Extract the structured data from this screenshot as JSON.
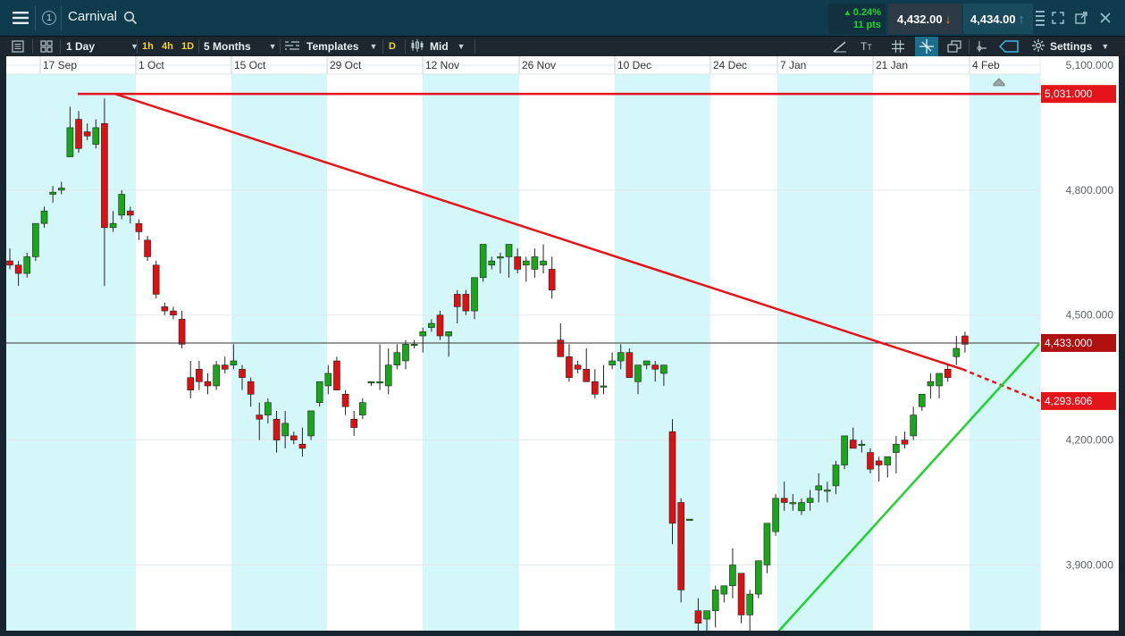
{
  "topbar": {
    "menu_icon": "hamburger-menu-icon",
    "badge": "1",
    "title": "Carnival",
    "search_icon": "search-icon",
    "change_pct": "0.24%",
    "change_pts": "11 pts",
    "sell_price": "4,432.00",
    "buy_price": "4,434.00",
    "colors": {
      "up": "#1fd32f",
      "sell_bg": "#2b3a44",
      "buy_bg": "#1a4b5d"
    }
  },
  "toolbar": {
    "interval": "1 Day",
    "btn_1h": "1h",
    "btn_4h": "4h",
    "btn_1d": "1D",
    "period": "5 Months",
    "templates": "Templates",
    "d": "D",
    "price_type": "Mid",
    "settings": "Settings"
  },
  "chart_data": {
    "type": "candlestick",
    "title": "",
    "ylim": [
      3650,
      5130
    ],
    "y_ticks": [
      "5,100.000",
      "4,800.000",
      "4,500.000",
      "4,200.000",
      "3,900.000"
    ],
    "y_tick_values": [
      5100,
      4800,
      4500,
      4200,
      3900
    ],
    "x_ticks": [
      "17 Sep",
      "1 Oct",
      "15 Oct",
      "29 Oct",
      "12 Nov",
      "26 Nov",
      "10 Dec",
      "24 Dec",
      "7 Jan",
      "21 Jan",
      "4 Feb"
    ],
    "colors": {
      "up": "#1aa51a",
      "down": "#dd1111",
      "resistance": "#e4141a",
      "support": "#1fd32f"
    },
    "horizontal_line": {
      "value": 5031,
      "label": "5,031.000"
    },
    "last_price": {
      "value": 4433,
      "label": "4,433.000"
    },
    "trendline_label": {
      "value": 4293.606,
      "label": "4,293.606"
    },
    "candles": [
      [
        4630,
        4660,
        4610,
        4620
      ],
      [
        4620,
        4630,
        4570,
        4600
      ],
      [
        4600,
        4650,
        4590,
        4640
      ],
      [
        4640,
        4720,
        4630,
        4720
      ],
      [
        4720,
        4760,
        4710,
        4750
      ],
      [
        4790,
        4810,
        4770,
        4795
      ],
      [
        4800,
        4820,
        4790,
        4805
      ],
      [
        4880,
        5000,
        4880,
        4950
      ],
      [
        4970,
        4990,
        4890,
        4900
      ],
      [
        4940,
        4960,
        4920,
        4930
      ],
      [
        4910,
        4970,
        4900,
        4950
      ],
      [
        4960,
        5020,
        4570,
        4710
      ],
      [
        4710,
        4750,
        4700,
        4720
      ],
      [
        4740,
        4800,
        4730,
        4790
      ],
      [
        4750,
        4760,
        4720,
        4740
      ],
      [
        4720,
        4730,
        4680,
        4700
      ],
      [
        4680,
        4690,
        4630,
        4640
      ],
      [
        4620,
        4630,
        4540,
        4550
      ],
      [
        4520,
        4530,
        4500,
        4510
      ],
      [
        4510,
        4520,
        4490,
        4500
      ],
      [
        4490,
        4510,
        4420,
        4430
      ],
      [
        4350,
        4390,
        4300,
        4320
      ],
      [
        4370,
        4390,
        4320,
        4340
      ],
      [
        4340,
        4360,
        4310,
        4330
      ],
      [
        4330,
        4390,
        4320,
        4380
      ],
      [
        4380,
        4400,
        4360,
        4370
      ],
      [
        4380,
        4430,
        4370,
        4390
      ],
      [
        4370,
        4380,
        4320,
        4350
      ],
      [
        4340,
        4350,
        4280,
        4310
      ],
      [
        4260,
        4290,
        4200,
        4250
      ],
      [
        4260,
        4300,
        4240,
        4290
      ],
      [
        4250,
        4270,
        4170,
        4200
      ],
      [
        4210,
        4270,
        4180,
        4240
      ],
      [
        4210,
        4220,
        4190,
        4200
      ],
      [
        4190,
        4230,
        4160,
        4180
      ],
      [
        4210,
        4270,
        4200,
        4270
      ],
      [
        4290,
        4340,
        4280,
        4340
      ],
      [
        4330,
        4380,
        4310,
        4360
      ],
      [
        4390,
        4400,
        4320,
        4320
      ],
      [
        4310,
        4320,
        4260,
        4280
      ],
      [
        4250,
        4270,
        4210,
        4230
      ],
      [
        4260,
        4300,
        4250,
        4290
      ],
      [
        4340,
        4340,
        4330,
        4340
      ],
      [
        4340,
        4430,
        4320,
        4340
      ],
      [
        4330,
        4420,
        4310,
        4380
      ],
      [
        4380,
        4430,
        4370,
        4410
      ],
      [
        4390,
        4440,
        4370,
        4430
      ],
      [
        4430,
        4440,
        4420,
        4430
      ],
      [
        4450,
        4470,
        4410,
        4460
      ],
      [
        4470,
        4490,
        4460,
        4480
      ],
      [
        4500,
        4510,
        4440,
        4450
      ],
      [
        4450,
        4460,
        4400,
        4460
      ],
      [
        4550,
        4560,
        4480,
        4520
      ],
      [
        4550,
        4560,
        4500,
        4510
      ],
      [
        4510,
        4590,
        4490,
        4590
      ],
      [
        4590,
        4650,
        4580,
        4670
      ],
      [
        4620,
        4640,
        4610,
        4630
      ],
      [
        4640,
        4650,
        4600,
        4640
      ],
      [
        4640,
        4660,
        4590,
        4670
      ],
      [
        4640,
        4660,
        4600,
        4610
      ],
      [
        4620,
        4640,
        4580,
        4630
      ],
      [
        4610,
        4660,
        4590,
        4640
      ],
      [
        4620,
        4670,
        4600,
        4630
      ],
      [
        4610,
        4640,
        4540,
        4560
      ],
      [
        4440,
        4480,
        4400,
        4400
      ],
      [
        4400,
        4430,
        4340,
        4350
      ],
      [
        4380,
        4390,
        4360,
        4370
      ],
      [
        4370,
        4420,
        4340,
        4340
      ],
      [
        4340,
        4370,
        4300,
        4310
      ],
      [
        4330,
        4380,
        4310,
        4330
      ],
      [
        4380,
        4410,
        4370,
        4390
      ],
      [
        4390,
        4430,
        4370,
        4410
      ],
      [
        4410,
        4420,
        4350,
        4350
      ],
      [
        4340,
        4380,
        4310,
        4380
      ],
      [
        4380,
        4390,
        4370,
        4390
      ],
      [
        4380,
        4390,
        4340,
        4370
      ],
      [
        4360,
        4380,
        4330,
        4380
      ],
      [
        4220,
        4250,
        3950,
        4000
      ],
      [
        4050,
        4060,
        3810,
        3840
      ],
      [
        4010,
        4010,
        4010,
        4010
      ],
      [
        3790,
        3820,
        3740,
        3760
      ],
      [
        3770,
        3790,
        3720,
        3790
      ],
      [
        3790,
        3850,
        3750,
        3840
      ],
      [
        3830,
        3840,
        3810,
        3850
      ],
      [
        3850,
        3940,
        3820,
        3900
      ],
      [
        3880,
        3880,
        3760,
        3780
      ],
      [
        3780,
        3840,
        3720,
        3830
      ],
      [
        3830,
        3900,
        3820,
        3910
      ],
      [
        3900,
        3990,
        3880,
        4000
      ],
      [
        3980,
        4070,
        3970,
        4060
      ],
      [
        4060,
        4100,
        4030,
        4050
      ],
      [
        4050,
        4070,
        4030,
        4050
      ],
      [
        4030,
        4060,
        4020,
        4050
      ],
      [
        4050,
        4080,
        4030,
        4060
      ],
      [
        4080,
        4120,
        4050,
        4090
      ],
      [
        4080,
        4100,
        4050,
        4080
      ],
      [
        4090,
        4150,
        4070,
        4140
      ],
      [
        4140,
        4190,
        4130,
        4210
      ],
      [
        4200,
        4230,
        4180,
        4180
      ],
      [
        4190,
        4200,
        4170,
        4190
      ],
      [
        4170,
        4180,
        4120,
        4130
      ],
      [
        4150,
        4160,
        4100,
        4140
      ],
      [
        4140,
        4150,
        4110,
        4160
      ],
      [
        4170,
        4210,
        4120,
        4190
      ],
      [
        4200,
        4220,
        4180,
        4190
      ],
      [
        4210,
        4280,
        4200,
        4260
      ],
      [
        4280,
        4310,
        4270,
        4310
      ],
      [
        4330,
        4360,
        4300,
        4340
      ],
      [
        4330,
        4360,
        4300,
        4360
      ],
      [
        4370,
        4380,
        4340,
        4350
      ],
      [
        4400,
        4450,
        4380,
        4420
      ],
      [
        4450,
        4460,
        4410,
        4430
      ]
    ]
  }
}
